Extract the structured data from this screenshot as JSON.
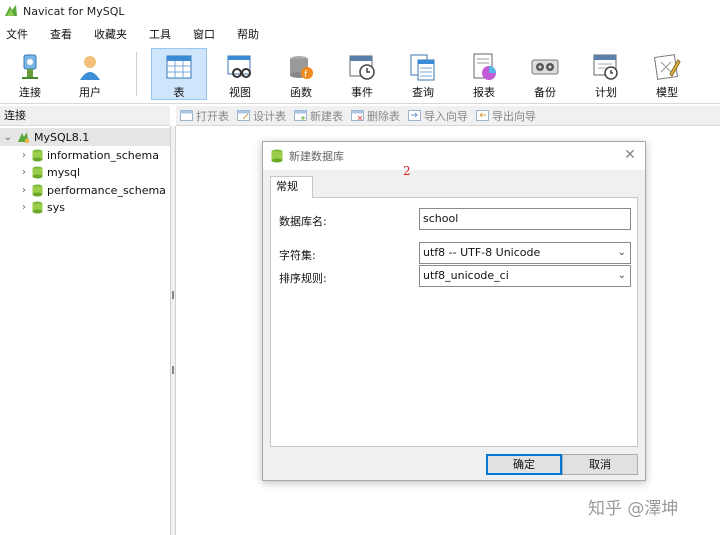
{
  "window": {
    "title": "Navicat for MySQL"
  },
  "menu": [
    "文件",
    "查看",
    "收藏夹",
    "工具",
    "窗口",
    "帮助"
  ],
  "toolbar": {
    "connect": "连接",
    "user": "用户",
    "table": "表",
    "view": "视图",
    "function": "函数",
    "event": "事件",
    "query": "查询",
    "report": "报表",
    "backup": "备份",
    "schedule": "计划",
    "model": "模型"
  },
  "sidebar": {
    "header": "连接",
    "connection": "MySQL8.1",
    "databases": [
      "information_schema",
      "mysql",
      "performance_schema",
      "sys"
    ]
  },
  "object_toolbar": {
    "open": "打开表",
    "design": "设计表",
    "new": "新建表",
    "delete": "删除表",
    "import": "导入向导",
    "export": "导出向导"
  },
  "dialog": {
    "title": "新建数据库",
    "annotation": "2",
    "tab": "常规",
    "db_name_label": "数据库名:",
    "db_name_value": "school",
    "charset_label": "字符集:",
    "charset_value": "utf8 -- UTF-8 Unicode",
    "collation_label": "排序规则:",
    "collation_value": "utf8_unicode_ci",
    "ok": "确定",
    "cancel": "取消"
  },
  "watermark": "知乎 @澤坤",
  "colors": {
    "selected_tool_bg": "#cfe5fb",
    "accent": "#0078d7",
    "annotation": "#dd2222"
  }
}
